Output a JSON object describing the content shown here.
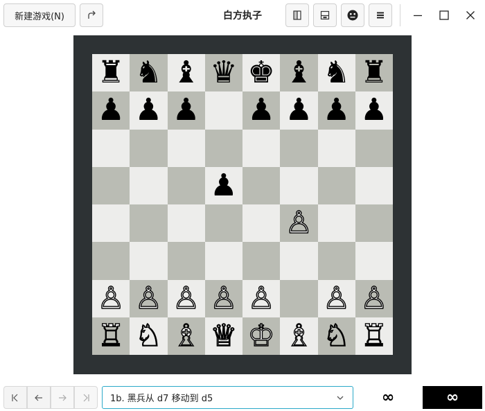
{
  "header": {
    "new_game_label": "新建游戏(N)",
    "title": "白方执子",
    "icons": [
      "redo-icon",
      "flip-board-icon",
      "save-icon",
      "face-icon",
      "menu-icon",
      "minimize-icon",
      "maximize-icon",
      "close-icon"
    ]
  },
  "board": {
    "ranks": [
      [
        "♜",
        "♞",
        "♝",
        "♛",
        "♚",
        "♝",
        "♞",
        "♜"
      ],
      [
        "♟",
        "♟",
        "♟",
        "",
        "♟",
        "♟",
        "♟",
        "♟"
      ],
      [
        "",
        "",
        "",
        "",
        "",
        "",
        "",
        ""
      ],
      [
        "",
        "",
        "",
        "♟",
        "",
        "",
        "",
        ""
      ],
      [
        "",
        "",
        "",
        "",
        "",
        "♙",
        "",
        ""
      ],
      [
        "",
        "",
        "",
        "",
        "",
        "",
        "",
        ""
      ],
      [
        "♙",
        "♙",
        "♙",
        "♙",
        "♙",
        "",
        "♙",
        "♙"
      ],
      [
        "♖",
        "♘",
        "♗",
        "♕",
        "♔",
        "♗",
        "♘",
        "♖"
      ]
    ],
    "colors": {
      "frame": "#2d3234",
      "light": "#ededeb",
      "dark": "#babcb4"
    }
  },
  "footer": {
    "nav_icons": [
      "first-move-icon",
      "previous-move-icon",
      "next-move-icon",
      "last-move-icon"
    ],
    "move_text": "1b. 黑兵从 d7 移动到 d5",
    "white_clock": "∞",
    "black_clock": "∞"
  }
}
